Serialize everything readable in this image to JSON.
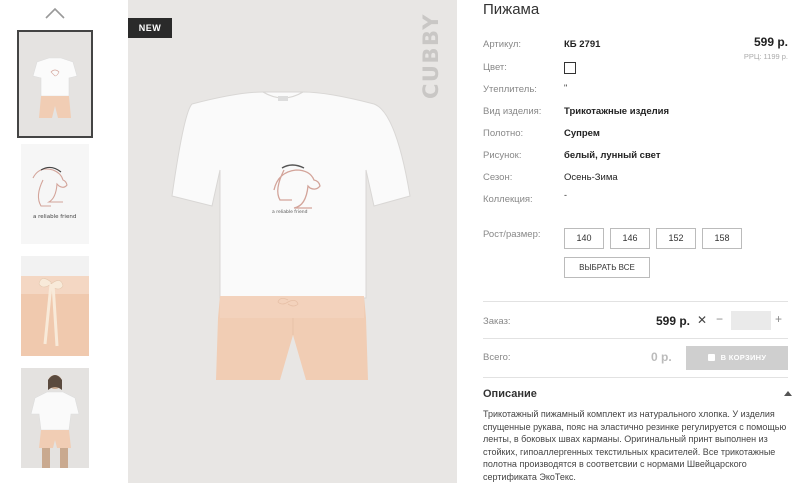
{
  "badge": "NEW",
  "brand": "CUBBY",
  "product": {
    "title": "Пижама",
    "price": "599 р.",
    "rrc": "РРЦ: 1199 р."
  },
  "details": [
    {
      "label": "Артикул:",
      "value": "КБ 2791"
    },
    {
      "label": "Цвет:",
      "value": ""
    },
    {
      "label": "Утеплитель:",
      "value": "\""
    },
    {
      "label": "Вид изделия:",
      "value": "Трикотажные изделия"
    },
    {
      "label": "Полотно:",
      "value": "Супрем"
    },
    {
      "label": "Рисунок:",
      "value": "белый, лунный свет"
    },
    {
      "label": "Сезон:",
      "value": "Осень-Зима"
    },
    {
      "label": "Коллекция:",
      "value": "-"
    }
  ],
  "sizes": {
    "label": "Рост/размер:",
    "options": [
      "140",
      "146",
      "152",
      "158"
    ],
    "select_all": "ВЫБРАТЬ ВСЕ"
  },
  "order": {
    "label": "Заказ:",
    "price": "599 р.",
    "times": "✕",
    "minus": "−",
    "plus": "+",
    "quantity": ""
  },
  "total": {
    "label": "Всего:",
    "value": "0 р.",
    "cart_button": "В КОРЗИНУ"
  },
  "description": {
    "title": "Описание",
    "text": "Трикотажный пижамный комплект из натурального хлопка. У изделия спущенные рукава, пояс на эластично резинке регулируется с помощью ленты, в боковых швах карманы. Оригинальный принт выполнен из стойких, гипоаллергенных текстильных красителей. Все трикотажные полотна производятся в соответсвии с нормами Швейцарского сертификата ЭкоТекс."
  },
  "print_text": "a reliable friend",
  "colors": {
    "swatch": "#ffffff",
    "tee": "#fafafa",
    "shorts": "#f1cdb4",
    "background": "#e8e6e4"
  }
}
